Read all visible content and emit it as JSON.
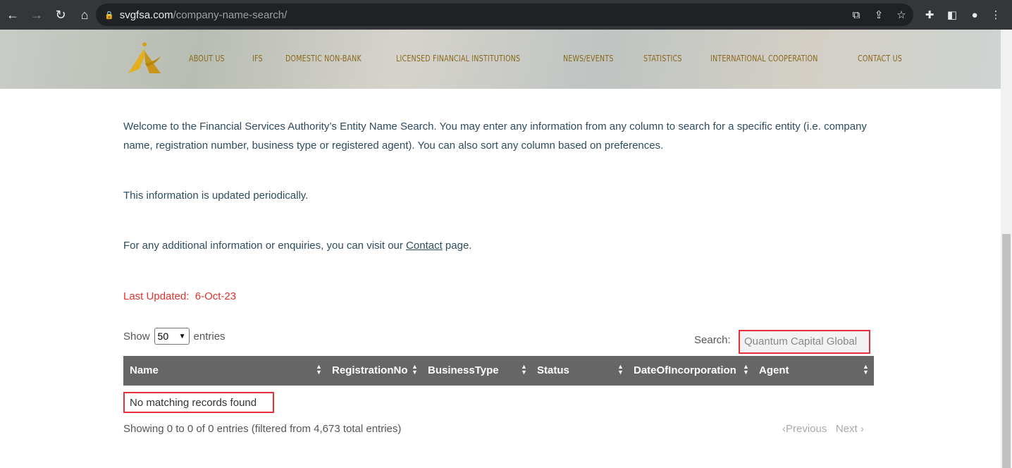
{
  "browser": {
    "url_host": "svgfsa.com",
    "url_path": "/company-name-search/"
  },
  "nav": [
    "ABOUT US",
    "IFS",
    "DOMESTIC NON-BANK",
    "LICENSED FINANCIAL INSTITUTIONS",
    "NEWS/EVENTS",
    "STATISTICS",
    "INTERNATIONAL COOPERATION",
    "CONTACT US"
  ],
  "intro": {
    "p1": "Welcome to the Financial Services Authority’s Entity Name Search. You may enter any information from any column to search for a specific entity (i.e. company name, registration number, business type or registered agent). You can also sort any column based on preferences.",
    "p2": "This information is updated periodically.",
    "p3_before": "For any additional information or enquiries, you can visit our ",
    "p3_link": "Contact",
    "p3_after": " page.",
    "last_updated_label": "Last Updated:",
    "last_updated_value": "6-Oct-23"
  },
  "table": {
    "show_label": "Show",
    "entries_label": "entries",
    "page_size": "50",
    "search_label": "Search:",
    "search_value": "Quantum Capital Global",
    "columns": [
      "Name",
      "RegistrationNo",
      "BusinessType",
      "Status",
      "DateOfIncorporation",
      "Agent"
    ],
    "empty": "No matching records found",
    "info": "Showing 0 to 0 of 0 entries (filtered from 4,673 total entries)",
    "previous": "Previous",
    "next": "Next"
  },
  "colors": {
    "highlight": "#e8303a",
    "header_bg": "#666666",
    "nav_text": "#8a6a1c",
    "last_updated": "#e0312c"
  }
}
